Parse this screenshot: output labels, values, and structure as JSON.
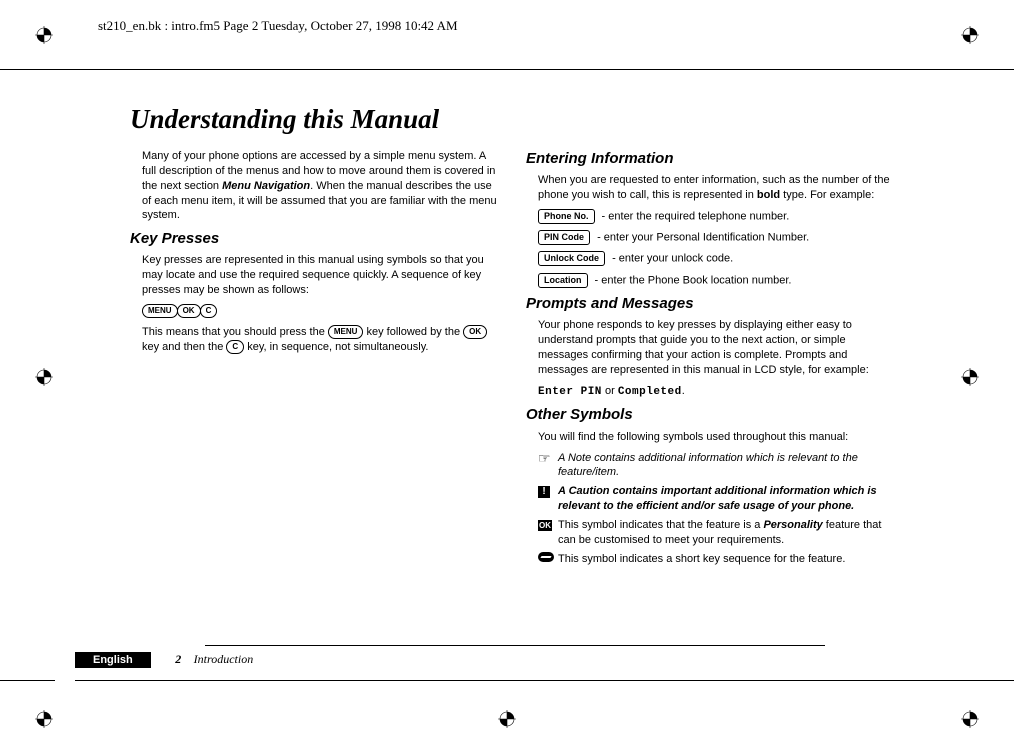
{
  "header": "st210_en.bk : intro.fm5  Page 2  Tuesday, October 27, 1998  10:42 AM",
  "title": "Understanding this Manual",
  "intro": "Many of your phone options are accessed by a simple menu system. A full description of the menus and how to move around them is covered in the next section ",
  "intro_bold": "Menu Navigation",
  "intro2": ". When the manual describes the use of each menu item, it will be assumed that you are familiar with the menu system.",
  "kp_h": "Key Presses",
  "kp1": "Key presses are represented in this manual using symbols so that you may locate and use the required sequence quickly. A sequence of key presses may be shown as follows:",
  "kp_keys": {
    "menu": "MENU",
    "ok": "OK",
    "c": "C"
  },
  "kp2a": "This means that you should press the ",
  "kp2b": " key followed by the ",
  "kp2c": " key and then the ",
  "kp2d": " key, in sequence, not simultaneously.",
  "ei_h": "Entering Information",
  "ei1a": "When you are requested to enter information, such as the number of the phone you wish to call, this is represented in ",
  "ei1b": "bold",
  "ei1c": " type. For example:",
  "ei_rows": [
    {
      "lbl": "Phone No.",
      "txt": " - enter the required telephone number."
    },
    {
      "lbl": "PIN Code",
      "txt": " - enter your Personal Identification Number."
    },
    {
      "lbl": "Unlock Code",
      "txt": " - enter your unlock code."
    },
    {
      "lbl": "Location",
      "txt": " - enter the Phone Book location number."
    }
  ],
  "pm_h": "Prompts and Messages",
  "pm1": "Your phone responds to key presses by displaying either easy to understand prompts that guide you to the next action, or simple messages confirming that your action is complete. Prompts and messages are represented in this manual in LCD style, for example:",
  "pm_lcd1": "Enter PIN",
  "pm_or": " or ",
  "pm_lcd2": "Completed",
  "pm_dot": ".",
  "os_h": "Other Symbols",
  "os1": "You will find the following symbols used throughout this manual:",
  "os_note": "A Note contains additional information which is relevant to the feature/item.",
  "os_caution": "A Caution contains important additional information which is relevant to the efficient and/or safe usage of your phone.",
  "os_ok_a": "This symbol indicates that the feature is a ",
  "os_ok_b": "Personality",
  "os_ok_c": " feature that can be customised to meet your requirements.",
  "os_short": "This symbol indicates a short key sequence for the feature.",
  "footer": {
    "lang": "English",
    "page": "2",
    "chapter": "Introduction"
  }
}
